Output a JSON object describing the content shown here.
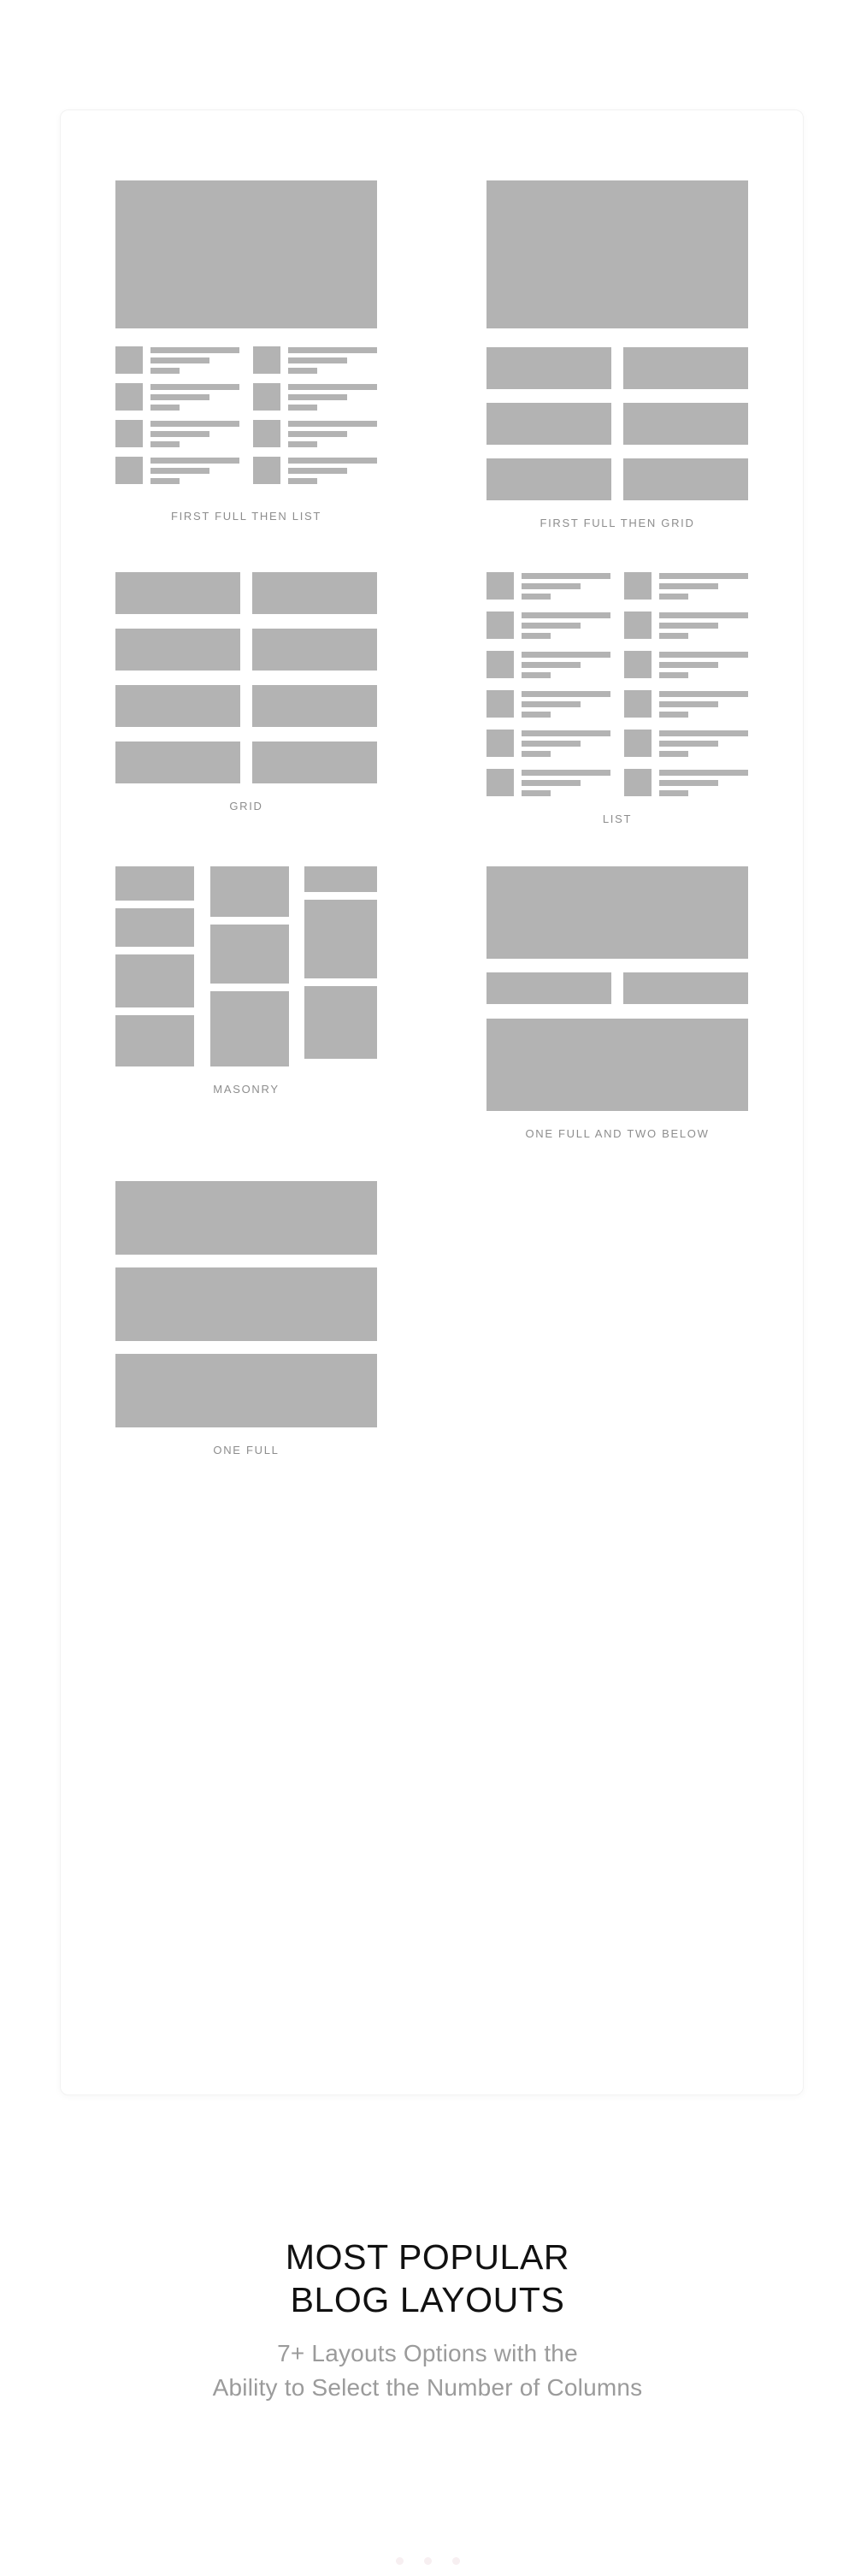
{
  "card": {
    "rows": [
      [
        {
          "id": "first-full-then-list",
          "label": "FIRST FULL THEN LIST",
          "preview_type": "hero-plus-list",
          "hero_count": 1,
          "list_rows": 4,
          "list_columns": 2
        },
        {
          "id": "first-full-then-grid",
          "label": "FIRST FULL THEN GRID",
          "preview_type": "hero-plus-grid",
          "hero_count": 1,
          "grid_rows": 3,
          "grid_columns": 2
        }
      ],
      [
        {
          "id": "grid",
          "label": "GRID",
          "preview_type": "grid",
          "grid_rows": 4,
          "grid_columns": 2
        },
        {
          "id": "list",
          "label": "LIST",
          "preview_type": "list",
          "list_rows": 6,
          "list_columns": 2
        }
      ],
      [
        {
          "id": "masonry",
          "label": "MASONRY",
          "preview_type": "masonry",
          "columns": 3,
          "column_block_heights": [
            [
              55,
              62,
              85,
              83
            ],
            [
              76,
              88,
              113
            ],
            [
              30,
              92,
              85
            ]
          ]
        },
        {
          "id": "one-full-and-two-below",
          "label": "ONE FULL AND TWO BELOW",
          "preview_type": "one-full-two-below",
          "hero_count": 1,
          "half_count": 2,
          "bottom_count": 1
        }
      ],
      [
        {
          "id": "one-full",
          "label": "ONE FULL",
          "preview_type": "one-full",
          "block_count": 3
        }
      ]
    ]
  },
  "footer": {
    "headline_line1": "MOST POPULAR",
    "headline_line2": "BLOG LAYOUTS",
    "subtitle_line1": "7+ Layouts Options with the",
    "subtitle_line2": "Ability to Select the Number of Columns"
  },
  "pagination": {
    "dot_count": 3,
    "dot_color": "#f7eff1"
  },
  "colors": {
    "placeholder": "#b3b3b3",
    "label": "#8d8d8d",
    "headline": "#111111",
    "subtitle": "#9b9b9b",
    "card_background": "#ffffff",
    "page_background": "#ffffff"
  }
}
